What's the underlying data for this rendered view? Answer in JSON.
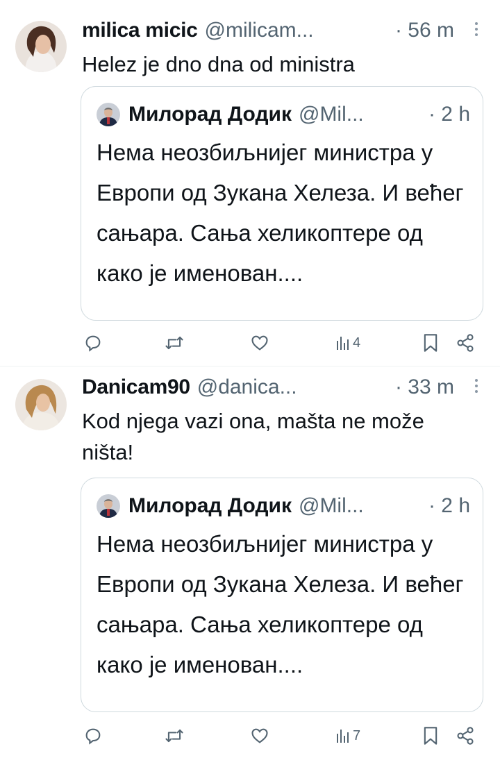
{
  "tweets": [
    {
      "name": "milica micic",
      "handle": "@milicam...",
      "time": "· 56 m",
      "text": "Helez je dno dna od ministra",
      "quote": {
        "name": "Милорад Додик",
        "handle": "@Mil...",
        "time": "· 2 h",
        "text": "Нема неозбиљнијег министра у Европи од Зукана Хелеза. И већег сањара. Сања хеликоптере од како је именован...."
      },
      "views": "4"
    },
    {
      "name": "Danicam90",
      "handle": "@danica...",
      "time": "· 33 m",
      "text": "Kod njega vazi ona, mašta ne može ništa!",
      "quote": {
        "name": "Милорад Додик",
        "handle": "@Mil...",
        "time": "· 2 h",
        "text": "Нема неозбиљнијег министра у Европи од Зукана Хелеза. И већег сањара. Сања хеликоптере од како је именован...."
      },
      "views": "7"
    }
  ],
  "icons": {
    "reply": "reply-icon",
    "retweet": "retweet-icon",
    "like": "heart-icon",
    "views": "views-chart-icon",
    "bookmark": "bookmark-icon",
    "share": "share-icon",
    "more": "more-dots-icon"
  },
  "colors": {
    "text": "#0f1419",
    "secondary": "#536471",
    "border": "#cfd9de"
  }
}
